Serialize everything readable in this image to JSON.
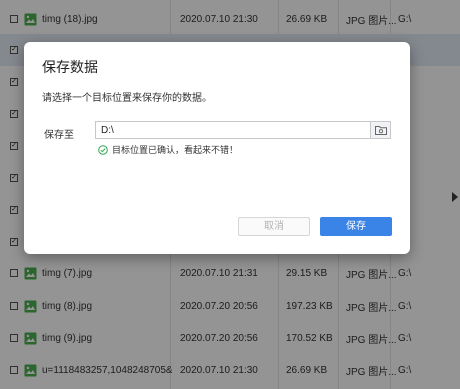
{
  "file_list": {
    "rows": [
      {
        "checked": false,
        "selected": false,
        "name": "timg (18).jpg",
        "date": "2020.07.10 21:30",
        "size": "26.69 KB",
        "type": "JPG 图片...",
        "path": "G:\\"
      },
      {
        "checked": true,
        "selected": true,
        "name": "",
        "date": "",
        "size": "",
        "type": "",
        "path": ""
      },
      {
        "checked": true,
        "selected": false,
        "name": "",
        "date": "",
        "size": "",
        "type": "",
        "path": ""
      },
      {
        "checked": true,
        "selected": false,
        "name": "",
        "date": "",
        "size": "",
        "type": "",
        "path": ""
      },
      {
        "checked": true,
        "selected": false,
        "name": "",
        "date": "",
        "size": "",
        "type": "",
        "path": ""
      },
      {
        "checked": true,
        "selected": false,
        "name": "",
        "date": "",
        "size": "",
        "type": "",
        "path": ""
      },
      {
        "checked": true,
        "selected": false,
        "name": "",
        "date": "",
        "size": "",
        "type": "",
        "path": ""
      },
      {
        "checked": true,
        "selected": false,
        "name": "",
        "date": "",
        "size": "",
        "type": "",
        "path": ""
      },
      {
        "checked": false,
        "selected": false,
        "name": "timg (7).jpg",
        "date": "2020.07.10 21:31",
        "size": "29.15 KB",
        "type": "JPG 图片...",
        "path": "G:\\"
      },
      {
        "checked": false,
        "selected": false,
        "name": "timg (8).jpg",
        "date": "2020.07.20 20:56",
        "size": "197.23 KB",
        "type": "JPG 图片...",
        "path": "G:\\"
      },
      {
        "checked": false,
        "selected": false,
        "name": "timg (9).jpg",
        "date": "2020.07.20 20:56",
        "size": "170.52 KB",
        "type": "JPG 图片...",
        "path": "G:\\"
      },
      {
        "checked": false,
        "selected": false,
        "name": "u=1118483257,1048248705&...",
        "date": "2020.07.10 21:30",
        "size": "26.69 KB",
        "type": "JPG 图片...",
        "path": "G:\\"
      }
    ]
  },
  "dialog": {
    "title": "保存数据",
    "description": "请选择一个目标位置来保存你的数据。",
    "save_to_label": "保存至",
    "path_value": "D:\\",
    "status_text": "目标位置已确认，看起来不错！",
    "cancel_label": "取消",
    "save_label": "保存"
  },
  "colors": {
    "accent": "#3a84e8",
    "success": "#2fa84f",
    "image_icon": "#4caf50"
  },
  "icons": {
    "file": "image-file-icon",
    "folder": "folder-icon",
    "status": "check-circle-icon",
    "scroll": "arrow-right-icon"
  }
}
